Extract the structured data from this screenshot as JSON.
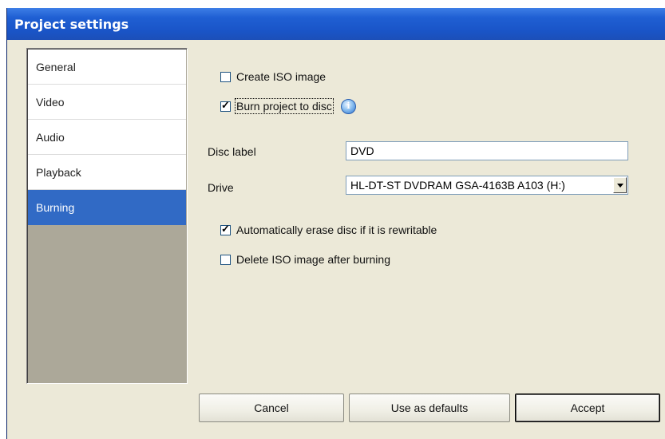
{
  "window": {
    "title": "Project settings"
  },
  "nav": {
    "items": [
      {
        "label": "General"
      },
      {
        "label": "Video"
      },
      {
        "label": "Audio"
      },
      {
        "label": "Playback"
      },
      {
        "label": "Burning",
        "selected": true
      }
    ]
  },
  "options": {
    "create_iso": {
      "label": "Create ISO image",
      "checked": false
    },
    "burn_to_disc": {
      "label": "Burn project to disc",
      "checked": true,
      "info_icon": "info-icon"
    },
    "auto_erase": {
      "label": "Automatically erase disc if it is rewritable",
      "checked": true
    },
    "delete_iso": {
      "label": "Delete ISO image after burning",
      "checked": false
    }
  },
  "disc_label": {
    "label": "Disc label",
    "value": "DVD"
  },
  "drive": {
    "label": "Drive",
    "selected": "HL-DT-ST DVDRAM GSA-4163B A103 (H:)"
  },
  "buttons": {
    "cancel": "Cancel",
    "defaults": "Use as defaults",
    "accept": "Accept"
  },
  "colors": {
    "titlebar": "#1f5fd3",
    "selection": "#316ac5",
    "dialog_bg": "#ece9d8"
  }
}
